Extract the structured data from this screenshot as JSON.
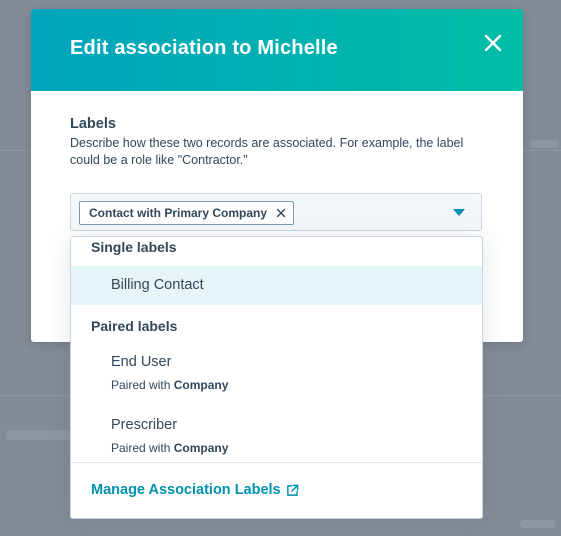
{
  "modal": {
    "title": "Edit association to Michelle",
    "close_icon": "close-icon"
  },
  "labels": {
    "heading": "Labels",
    "description": "Describe how these two records are associated. For example, the label could be a role like \"Contractor.\""
  },
  "select": {
    "selected_tags": [
      {
        "label": "Contact with Primary Company"
      }
    ],
    "caret_icon": "caret-down-icon"
  },
  "dropdown": {
    "groups": [
      {
        "label": "Single labels",
        "options": [
          {
            "title": "Billing Contact",
            "highlighted": true
          }
        ]
      },
      {
        "label": "Paired labels",
        "options": [
          {
            "title": "End User",
            "paired_prefix": "Paired with",
            "paired_with": "Company"
          },
          {
            "title": "Prescriber",
            "paired_prefix": "Paired with",
            "paired_with": "Company"
          }
        ]
      }
    ],
    "footer_link": "Manage Association Labels",
    "footer_icon": "external-link-icon"
  },
  "colors": {
    "header_gradient_start": "#00a4bd",
    "header_gradient_end": "#00bda5",
    "link": "#0091ae",
    "text": "#33475b",
    "highlight": "#e5f5f8"
  }
}
